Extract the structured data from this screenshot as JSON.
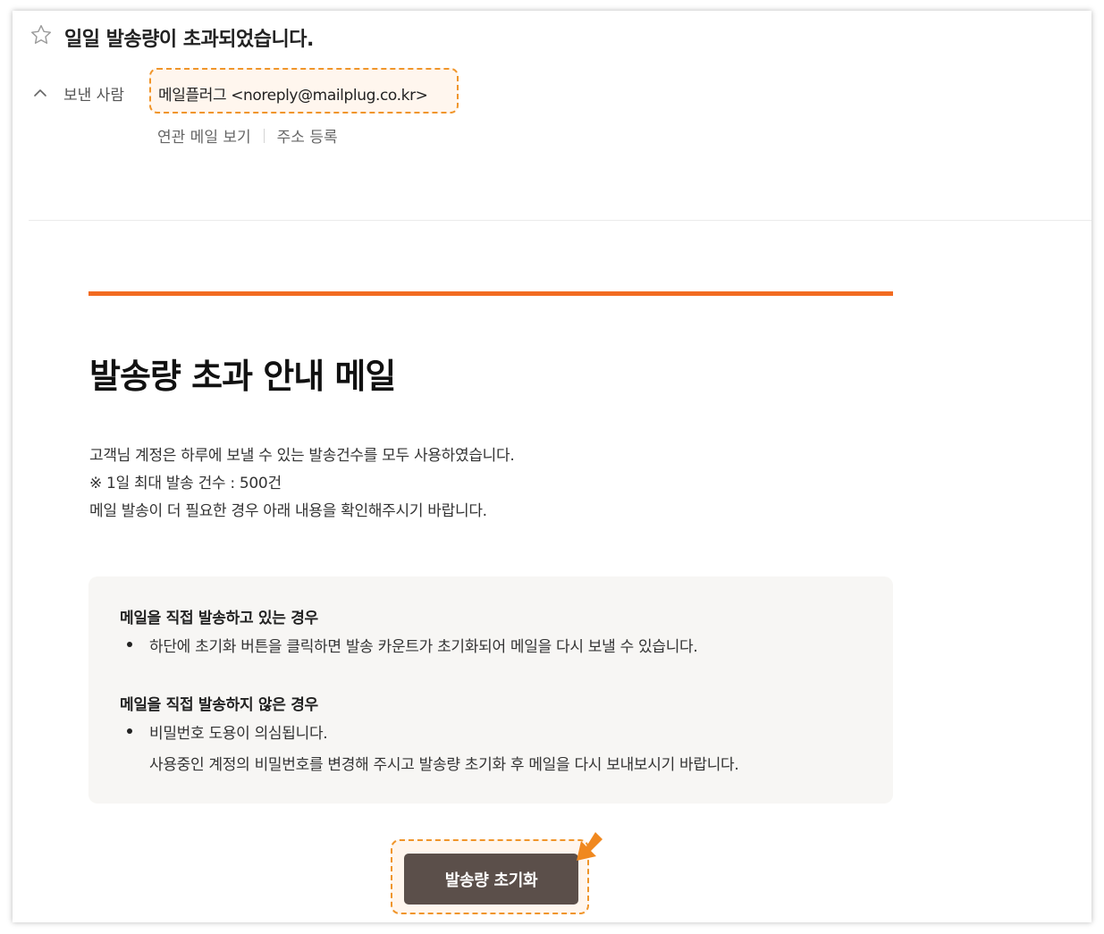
{
  "header": {
    "subject": "일일 발송량이 초과되었습니다.",
    "sender_label": "보낸 사람",
    "sender_address": "메일플러그 <noreply@mailplug.co.kr>",
    "related_mail_link": "연관 메일 보기",
    "add_address_link": "주소 등록"
  },
  "body": {
    "title": "발송량 초과 안내 메일",
    "desc_line1": "고객님 계정은 하루에 보낼 수 있는 발송건수를 모두 사용하였습니다.",
    "desc_line2": "※ 1일 최대 발송 건수 : 500건",
    "desc_line3": "메일 발송이 더 필요한 경우 아래 내용을 확인해주시기 바랍니다.",
    "section1_heading": "메일을 직접 발송하고 있는 경우",
    "section1_item": "하단에 초기화 버튼을 클릭하면 발송 카운트가 초기화되어 메일을 다시 보낼 수 있습니다.",
    "section2_heading": "메일을 직접 발송하지 않은 경우",
    "section2_item_line1": "비밀번호 도용이 의심됩니다.",
    "section2_item_line2": "사용중인 계정의 비밀번호를 변경해 주시고 발송량 초기화 후 메일을 다시 보내보시기 바랍니다.",
    "reset_button_label": "발송량 초기화"
  },
  "colors": {
    "accent": "#f26b21",
    "highlight_border": "#f0952a",
    "button": "#5b4f4a"
  },
  "icons": {
    "star": "star-icon",
    "collapse": "chevron-up-icon",
    "pointer": "arrow-pointer-icon"
  }
}
